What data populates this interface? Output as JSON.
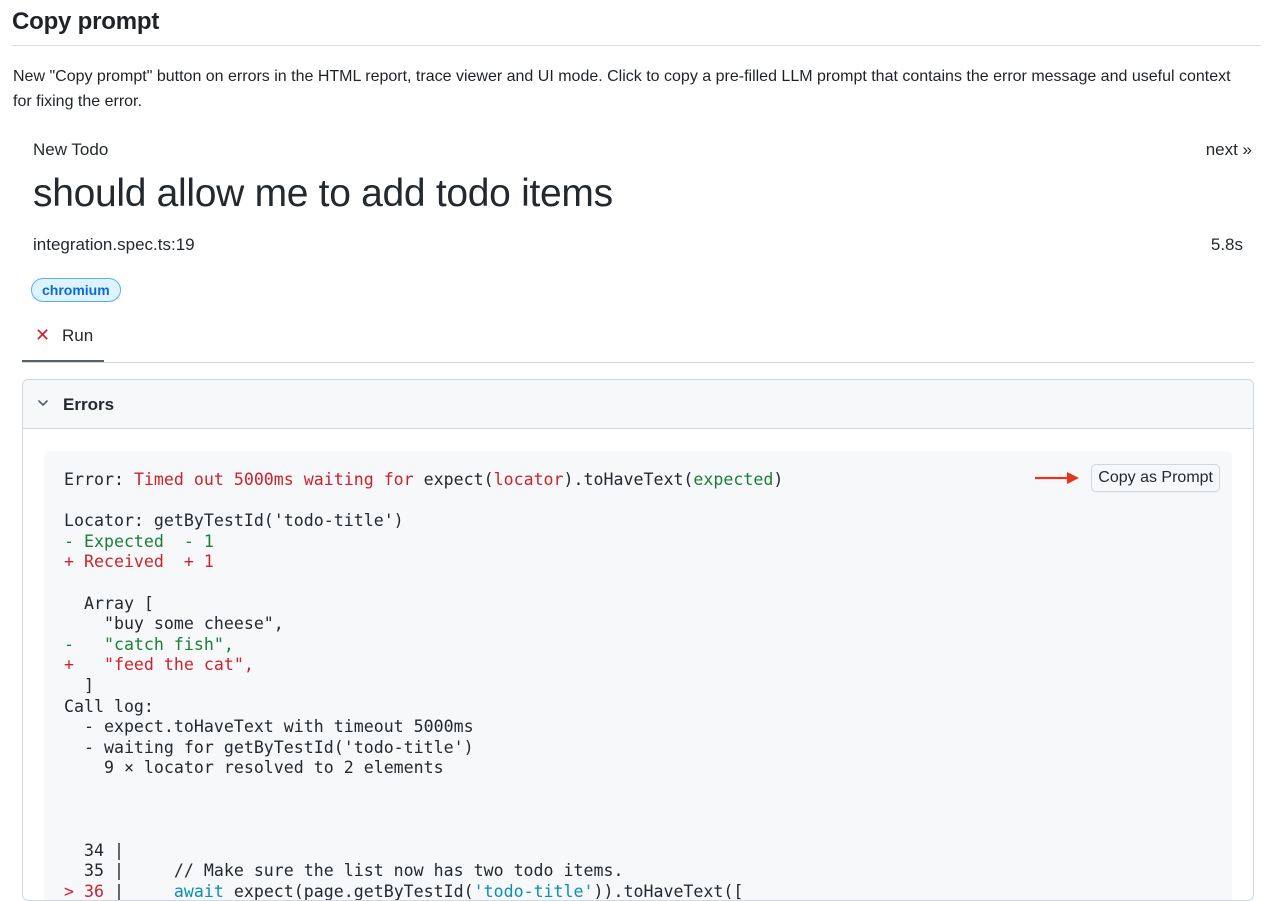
{
  "page": {
    "title": "Copy prompt",
    "intro": "New \"Copy prompt\" button on errors in the HTML report, trace viewer and UI mode. Click to copy a pre-filled LLM prompt that contains the error message and useful context for fixing the error."
  },
  "report": {
    "suite": "New Todo",
    "next_link": "next »",
    "test_title": "should allow me to add todo items",
    "location": "integration.spec.ts:19",
    "duration": "5.8s",
    "project_badge": "chromium",
    "run_tab": {
      "icon": "close-x-icon",
      "label": "Run"
    },
    "errors_section": {
      "label": "Errors",
      "icon": "chevron-down-icon"
    },
    "copy_button": "Copy as Prompt",
    "arrow_color": "#e8341c",
    "error_lines": [
      [
        {
          "t": "Error: "
        },
        {
          "t": "Timed out 5000ms waiting for",
          "c": "red"
        },
        {
          "t": " expect("
        },
        {
          "t": "locator",
          "c": "red"
        },
        {
          "t": ").toHaveText("
        },
        {
          "t": "expected",
          "c": "green"
        },
        {
          "t": ")"
        }
      ],
      [],
      [
        {
          "t": "Locator: getByTestId('todo-title')"
        }
      ],
      [
        {
          "t": "- Expected  - 1",
          "c": "green"
        }
      ],
      [
        {
          "t": "+ Received  + 1",
          "c": "red"
        }
      ],
      [],
      [
        {
          "t": "  Array ["
        }
      ],
      [
        {
          "t": "    \"buy some cheese\","
        }
      ],
      [
        {
          "t": "-   \"catch fish\",",
          "c": "green"
        }
      ],
      [
        {
          "t": "+   \"feed the cat\",",
          "c": "red"
        }
      ],
      [
        {
          "t": "  ]"
        }
      ],
      [
        {
          "t": "Call log:"
        }
      ],
      [
        {
          "t": "  - expect.toHaveText with timeout 5000ms"
        }
      ],
      [
        {
          "t": "  - waiting for getByTestId('todo-title')"
        }
      ],
      [
        {
          "t": "    9 × locator resolved to 2 elements"
        }
      ],
      [],
      [],
      [],
      [
        {
          "t": "  34 |"
        }
      ],
      [
        {
          "t": "  35 |     // Make sure the list now has two todo items."
        }
      ],
      [
        {
          "t": "> 36",
          "c": "red"
        },
        {
          "t": " |     "
        },
        {
          "t": "await",
          "c": "cyan"
        },
        {
          "t": " expect(page.getByTestId("
        },
        {
          "t": "'todo-title'",
          "c": "cyan"
        },
        {
          "t": ")).toHaveText(["
        }
      ]
    ]
  }
}
